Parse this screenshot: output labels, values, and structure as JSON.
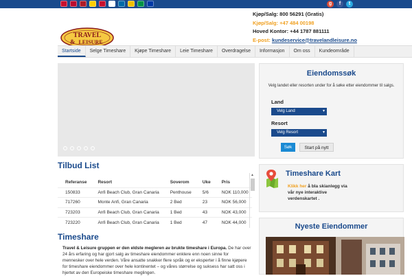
{
  "colors": {
    "topbar": "#1a4a8c",
    "accent_orange": "#f0a020",
    "heading_blue": "#1a4a8c",
    "button_blue": "#1a8ad4"
  },
  "flags": [
    {
      "name": "uk-flag-icon",
      "color": "#c8102e"
    },
    {
      "name": "norway-flag-icon",
      "color": "#ba0c2f"
    },
    {
      "name": "netherlands-flag-icon",
      "color": "#ae1c28"
    },
    {
      "name": "germany-flag-icon",
      "color": "#ffce00"
    },
    {
      "name": "denmark-flag-icon",
      "color": "#c8102e"
    },
    {
      "name": "finland-flag-icon",
      "color": "#ffffff"
    },
    {
      "name": "sweden-flag-icon",
      "color": "#006aa7"
    },
    {
      "name": "spain-flag-icon",
      "color": "#f1bf00"
    },
    {
      "name": "italy-flag-icon",
      "color": "#009246"
    },
    {
      "name": "russia-flag-icon",
      "color": "#0039a6"
    }
  ],
  "social": [
    {
      "name": "google-plus-icon",
      "glyph": "g",
      "color": "#d84b37"
    },
    {
      "name": "facebook-icon",
      "glyph": "f",
      "color": "#3b5998"
    },
    {
      "name": "twitter-icon",
      "glyph": "t",
      "color": "#2aa9e0"
    }
  ],
  "contact": {
    "line1": "Kjøp/Salg: 800 56291 (Gratis)",
    "line2": "Kjøp/Salg: +47 484 00198",
    "line3": "Hoved Kontor: +44 1787 881111",
    "line4_label": "E-post:",
    "line4_email": "kundeservice@travelandleisure.no"
  },
  "logo": {
    "word1": "TRAVEL",
    "word2": "LEISURE",
    "amp": "&"
  },
  "nav": [
    "Startside",
    "Selge Timeshare",
    "Kjøpe Timeshare",
    "Leie Timeshare",
    "Overdragelse",
    "Informasjon",
    "Om oss",
    "Kundeområde"
  ],
  "tilbud": {
    "title": "Tilbud List",
    "headers": [
      "Referanse",
      "Resort",
      "Soverom",
      "Uke",
      "Pris"
    ],
    "rows": [
      [
        "150833",
        "Anfi Beach Club, Gran Canaria",
        "Penthouse",
        "5/6",
        "NOK 110,000"
      ],
      [
        "717260",
        "Monte Anfi, Gran Canaria",
        "2 Bed",
        "23",
        "NOK 56,000"
      ],
      [
        "723203",
        "Anfi Beach Club, Gran Canaria",
        "1 Bed",
        "43",
        "NOK 43,000"
      ],
      [
        "723220",
        "Anfi Beach Club, Gran Canaria",
        "1 Bed",
        "47",
        "NOK 44,000"
      ]
    ]
  },
  "timeshare": {
    "title": "Timeshare",
    "intro_bold": "Travel & Leisure gruppen er den eldste megleren av brukte timeshare i Europa.",
    "intro_rest": " De har over 24 års erfaring og har gjort salg av timeshare eiendommer enklere enn noen sinne for mennesker over hele verden. Våre ansatte snakker flere språk og er eksperter i å finne kjøpere for timeshare eiendommer over hele kontinentet – og våres størrelse og suksess har satt oss i hjertet av den Europeiske timeshare meglingen."
  },
  "search": {
    "title": "Eiendomssøk",
    "description": "Velg landet eller resorten under for å søke etter eiendommer til salgs.",
    "land_label": "Land",
    "land_value": "Velg Land",
    "resort_label": "Resort",
    "resort_value": "Velg Resort",
    "search_button": "Søk",
    "reset_button": "Start på nytt"
  },
  "kart": {
    "title": "Timeshare Kart",
    "link": "Klikk her",
    "text": " å bla skianlegg via vår nye interaktive verdenskartet ."
  },
  "nyeste": {
    "title": "Nyeste Eiendommer"
  }
}
